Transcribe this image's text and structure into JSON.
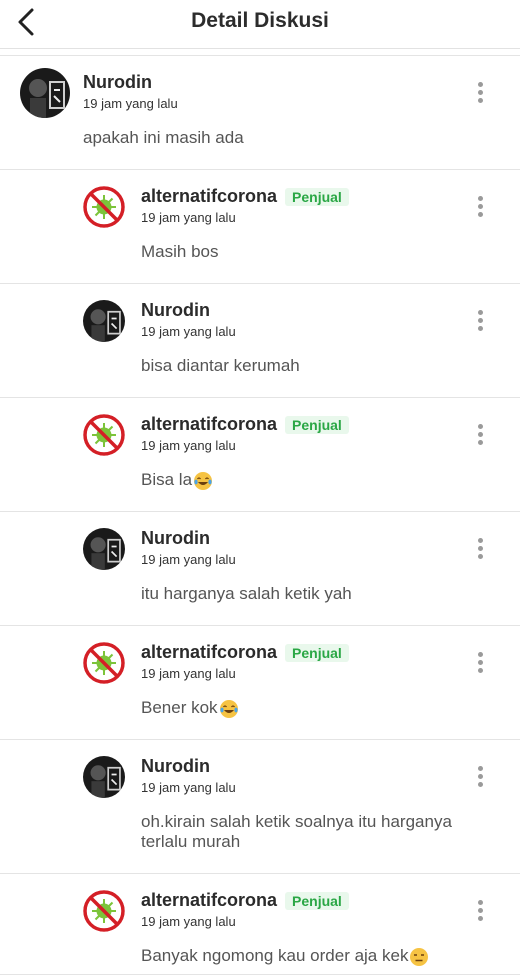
{
  "header": {
    "title": "Detail Diskusi",
    "back_icon": "chevron-left-icon"
  },
  "thread": {
    "main": {
      "author": "Nurodin",
      "time": "19 jam yang lalu",
      "text": "apakah ini masih ada"
    },
    "replies": [
      {
        "author": "alternatifcorona",
        "badge": "Penjual",
        "time": "19 jam yang lalu",
        "text": "Masih bos",
        "emoji": ""
      },
      {
        "author": "Nurodin",
        "badge": "",
        "time": "19 jam yang lalu",
        "text": "bisa diantar kerumah",
        "emoji": ""
      },
      {
        "author": "alternatifcorona",
        "badge": "Penjual",
        "time": "19 jam yang lalu",
        "text": "Bisa la",
        "emoji": "tears-of-joy"
      },
      {
        "author": "Nurodin",
        "badge": "",
        "time": "19 jam yang lalu",
        "text": "itu harganya salah ketik yah",
        "emoji": ""
      },
      {
        "author": "alternatifcorona",
        "badge": "Penjual",
        "time": "19 jam yang lalu",
        "text": "Bener kok",
        "emoji": "tears-of-joy"
      },
      {
        "author": "Nurodin",
        "badge": "",
        "time": "19 jam yang lalu",
        "text": "oh.kirain salah ketik soalnya itu harganya terlalu murah",
        "emoji": ""
      },
      {
        "author": "alternatifcorona",
        "badge": "Penjual",
        "time": "19 jam yang lalu",
        "text": "Banyak ngomong kau order aja kek",
        "emoji": "expressionless"
      }
    ]
  },
  "colors": {
    "badge_text": "#2aa745",
    "badge_bg": "#e9f8ec",
    "seller_ring": "#d41f26",
    "virus": "#7cc43a"
  }
}
